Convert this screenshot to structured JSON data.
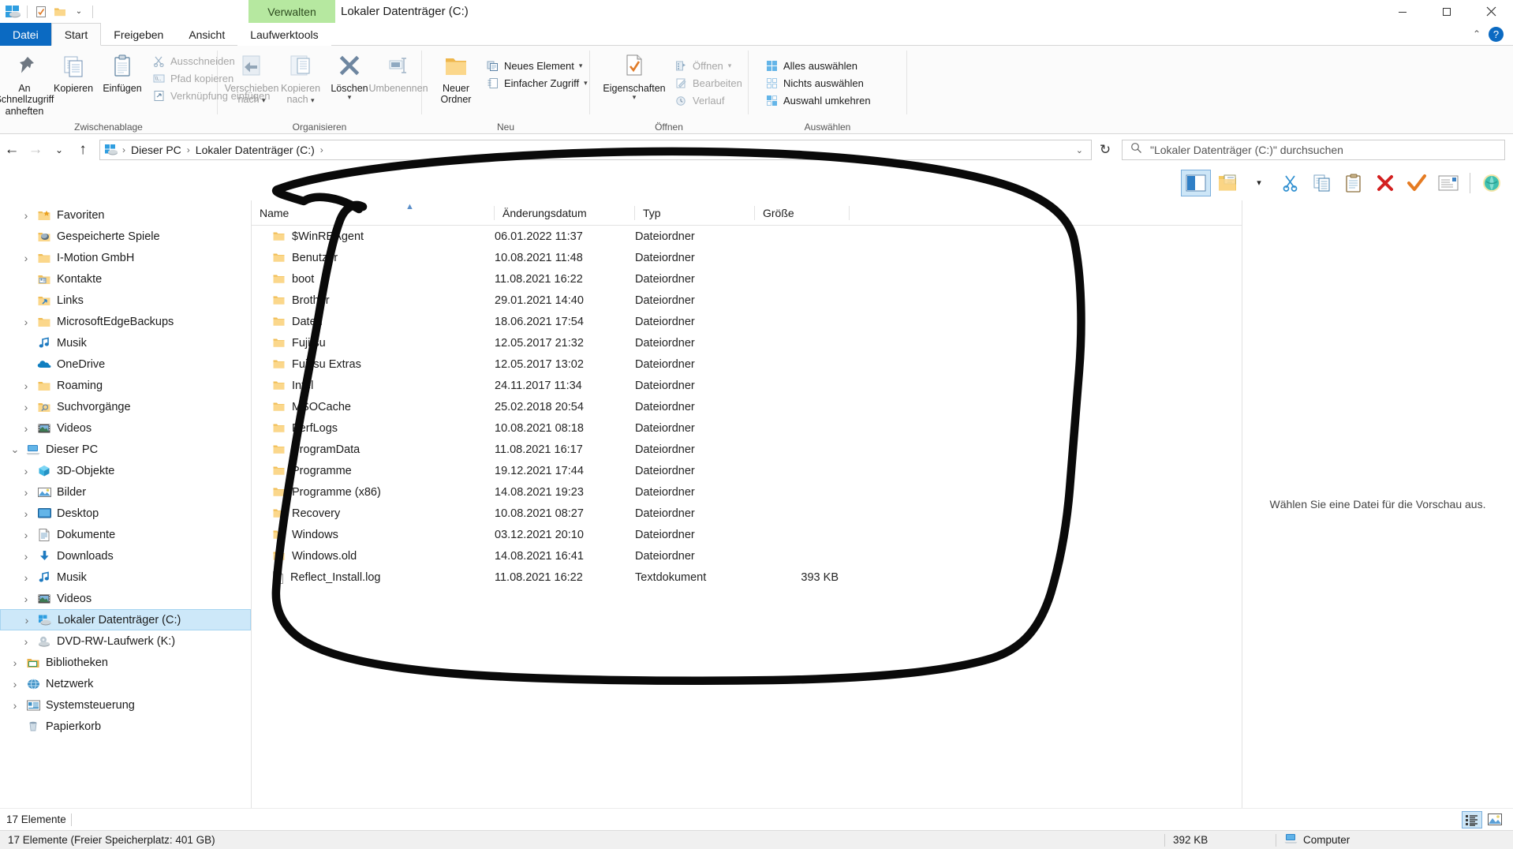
{
  "window": {
    "title": "Lokaler Datenträger (C:)",
    "contextual_tab": "Verwalten",
    "minimize": "–",
    "maximize": "▢",
    "close": "✕"
  },
  "quick_access": {
    "items": [
      "properties-icon",
      "new-folder-icon",
      "customize-dropdown"
    ]
  },
  "ribbon_tabs": [
    {
      "label": "Datei",
      "kind": "file"
    },
    {
      "label": "Start",
      "kind": "active"
    },
    {
      "label": "Freigeben",
      "kind": "normal"
    },
    {
      "label": "Ansicht",
      "kind": "normal"
    },
    {
      "label": "Laufwerktools",
      "kind": "contextual"
    }
  ],
  "ribbon_collapse_caret": "⌃",
  "help_label": "?",
  "ribbon": {
    "groups": [
      {
        "label": "Zwischenablage",
        "big": [
          {
            "label": "An Schnellzugriff\nanheften",
            "icon": "pin-icon",
            "disabled": false
          },
          {
            "label": "Kopieren",
            "icon": "copy-icon",
            "disabled": false
          },
          {
            "label": "Einfügen",
            "icon": "paste-icon",
            "disabled": false
          }
        ],
        "small": [
          {
            "label": "Ausschneiden",
            "icon": "scissors-icon",
            "disabled": true
          },
          {
            "label": "Pfad kopieren",
            "icon": "copy-path-icon",
            "disabled": true
          },
          {
            "label": "Verknüpfung einfügen",
            "icon": "paste-shortcut-icon",
            "disabled": true
          }
        ]
      },
      {
        "label": "Organisieren",
        "big": [
          {
            "label": "Verschieben\nnach",
            "icon": "move-to-icon",
            "disabled": true,
            "caret": true
          },
          {
            "label": "Kopieren\nnach",
            "icon": "copy-to-icon",
            "disabled": true,
            "caret": true
          },
          {
            "label": "Löschen",
            "icon": "delete-x-icon",
            "disabled": false,
            "caret": true
          },
          {
            "label": "Umbenennen",
            "icon": "rename-icon",
            "disabled": true
          }
        ],
        "small": []
      },
      {
        "label": "Neu",
        "big": [
          {
            "label": "Neuer\nOrdner",
            "icon": "new-folder-icon",
            "disabled": false
          }
        ],
        "small": [
          {
            "label": "Neues Element",
            "icon": "new-item-icon",
            "disabled": false,
            "caret": true
          },
          {
            "label": "Einfacher Zugriff",
            "icon": "easy-access-icon",
            "disabled": false,
            "caret": true
          }
        ]
      },
      {
        "label": "Öffnen",
        "big": [
          {
            "label": "Eigenschaften",
            "icon": "properties-check-icon",
            "disabled": false,
            "caret": true
          }
        ],
        "small": [
          {
            "label": "Öffnen",
            "icon": "open-icon",
            "disabled": true,
            "caret": true
          },
          {
            "label": "Bearbeiten",
            "icon": "edit-icon",
            "disabled": true
          },
          {
            "label": "Verlauf",
            "icon": "history-icon",
            "disabled": true
          }
        ]
      },
      {
        "label": "Auswählen",
        "big": [],
        "small": [
          {
            "label": "Alles auswählen",
            "icon": "select-all-icon",
            "disabled": false
          },
          {
            "label": "Nichts auswählen",
            "icon": "select-none-icon",
            "disabled": false
          },
          {
            "label": "Auswahl umkehren",
            "icon": "invert-selection-icon",
            "disabled": false
          }
        ]
      }
    ]
  },
  "nav": {
    "back": "←",
    "forward": "→",
    "recent": "⌄",
    "up": "↑",
    "refresh": "↻",
    "breadcrumb": [
      "Dieser PC",
      "Lokaler Datenträger (C:)"
    ],
    "breadcrumb_sep": "›",
    "dropdown_caret": "⌄"
  },
  "search": {
    "placeholder": "\"Lokaler Datenträger (C:)\" durchsuchen",
    "icon": "search-icon"
  },
  "toolbar2": {
    "buttons": [
      {
        "icon": "preview-pane-icon",
        "selected": true
      },
      {
        "icon": "folder-options-icon",
        "selected": false
      },
      {
        "icon": "dropdown-caret-icon",
        "selected": false
      },
      {
        "icon": "cut-scissors-icon",
        "selected": false
      },
      {
        "icon": "copy-icon",
        "selected": false
      },
      {
        "icon": "paste-clipboard-icon",
        "selected": false
      },
      {
        "icon": "delete-red-x-icon",
        "selected": false
      },
      {
        "icon": "confirm-orange-check-icon",
        "selected": false
      },
      {
        "icon": "rename-icon",
        "selected": false
      },
      {
        "icon": "shell-green-icon",
        "selected": false
      }
    ]
  },
  "sidebar": {
    "items": [
      {
        "label": "Favoriten",
        "icon": "favorites-folder-icon",
        "indent": 1,
        "chevron": true
      },
      {
        "label": "Gespeicherte Spiele",
        "icon": "saved-games-icon",
        "indent": 1,
        "chevron": false
      },
      {
        "label": "I-Motion GmbH",
        "icon": "folder-icon",
        "indent": 1,
        "chevron": true
      },
      {
        "label": "Kontakte",
        "icon": "contacts-icon",
        "indent": 1,
        "chevron": false
      },
      {
        "label": "Links",
        "icon": "links-folder-icon",
        "indent": 1,
        "chevron": false
      },
      {
        "label": "MicrosoftEdgeBackups",
        "icon": "folder-icon",
        "indent": 1,
        "chevron": true
      },
      {
        "label": "Musik",
        "icon": "music-note-icon",
        "indent": 1,
        "chevron": false
      },
      {
        "label": "OneDrive",
        "icon": "onedrive-cloud-icon",
        "indent": 1,
        "chevron": false
      },
      {
        "label": "Roaming",
        "icon": "folder-icon",
        "indent": 1,
        "chevron": true
      },
      {
        "label": "Suchvorgänge",
        "icon": "search-folder-icon",
        "indent": 1,
        "chevron": true
      },
      {
        "label": "Videos",
        "icon": "videos-icon",
        "indent": 1,
        "chevron": true
      },
      {
        "label": "Dieser PC",
        "icon": "this-pc-icon",
        "indent": 0,
        "chevron": true,
        "expanded": true
      },
      {
        "label": "3D-Objekte",
        "icon": "3d-objects-icon",
        "indent": 1,
        "chevron": true
      },
      {
        "label": "Bilder",
        "icon": "pictures-icon",
        "indent": 1,
        "chevron": true
      },
      {
        "label": "Desktop",
        "icon": "desktop-icon",
        "indent": 1,
        "chevron": true
      },
      {
        "label": "Dokumente",
        "icon": "documents-icon",
        "indent": 1,
        "chevron": true
      },
      {
        "label": "Downloads",
        "icon": "downloads-arrow-icon",
        "indent": 1,
        "chevron": true
      },
      {
        "label": "Musik",
        "icon": "music-note-icon",
        "indent": 1,
        "chevron": true
      },
      {
        "label": "Videos",
        "icon": "videos-icon",
        "indent": 1,
        "chevron": true
      },
      {
        "label": "Lokaler Datenträger (C:)",
        "icon": "local-disk-icon",
        "indent": 1,
        "chevron": true,
        "selected": true
      },
      {
        "label": "DVD-RW-Laufwerk (K:)",
        "icon": "dvd-drive-icon",
        "indent": 1,
        "chevron": true
      },
      {
        "label": "Bibliotheken",
        "icon": "libraries-icon",
        "indent": 0,
        "chevron": true
      },
      {
        "label": "Netzwerk",
        "icon": "network-icon",
        "indent": 0,
        "chevron": true
      },
      {
        "label": "Systemsteuerung",
        "icon": "control-panel-icon",
        "indent": 0,
        "chevron": true
      },
      {
        "label": "Papierkorb",
        "icon": "recycle-bin-icon",
        "indent": 0,
        "chevron": false
      }
    ]
  },
  "file_list": {
    "columns": [
      "Name",
      "Änderungsdatum",
      "Typ",
      "Größe"
    ],
    "sort_column": "Name",
    "sort_direction": "asc",
    "rows": [
      {
        "name": "$WinREAgent",
        "date": "06.01.2022 11:37",
        "type": "Dateiordner",
        "size": "",
        "icon": "folder-icon"
      },
      {
        "name": "Benutzer",
        "date": "10.08.2021 11:48",
        "type": "Dateiordner",
        "size": "",
        "icon": "folder-icon"
      },
      {
        "name": "boot",
        "date": "11.08.2021 16:22",
        "type": "Dateiordner",
        "size": "",
        "icon": "folder-icon"
      },
      {
        "name": "Brother",
        "date": "29.01.2021 14:40",
        "type": "Dateiordner",
        "size": "",
        "icon": "folder-icon"
      },
      {
        "name": "Daten",
        "date": "18.06.2021 17:54",
        "type": "Dateiordner",
        "size": "",
        "icon": "folder-icon"
      },
      {
        "name": "Fujitsu",
        "date": "12.05.2017 21:32",
        "type": "Dateiordner",
        "size": "",
        "icon": "folder-icon"
      },
      {
        "name": "Fujitsu Extras",
        "date": "12.05.2017 13:02",
        "type": "Dateiordner",
        "size": "",
        "icon": "folder-icon"
      },
      {
        "name": "Intel",
        "date": "24.11.2017 11:34",
        "type": "Dateiordner",
        "size": "",
        "icon": "folder-icon"
      },
      {
        "name": "MSOCache",
        "date": "25.02.2018 20:54",
        "type": "Dateiordner",
        "size": "",
        "icon": "folder-icon"
      },
      {
        "name": "PerfLogs",
        "date": "10.08.2021 08:18",
        "type": "Dateiordner",
        "size": "",
        "icon": "folder-icon"
      },
      {
        "name": "ProgramData",
        "date": "11.08.2021 16:17",
        "type": "Dateiordner",
        "size": "",
        "icon": "folder-icon"
      },
      {
        "name": "Programme",
        "date": "19.12.2021 17:44",
        "type": "Dateiordner",
        "size": "",
        "icon": "folder-icon"
      },
      {
        "name": "Programme (x86)",
        "date": "14.08.2021 19:23",
        "type": "Dateiordner",
        "size": "",
        "icon": "folder-icon"
      },
      {
        "name": "Recovery",
        "date": "10.08.2021 08:27",
        "type": "Dateiordner",
        "size": "",
        "icon": "folder-icon"
      },
      {
        "name": "Windows",
        "date": "03.12.2021 20:10",
        "type": "Dateiordner",
        "size": "",
        "icon": "folder-icon"
      },
      {
        "name": "Windows.old",
        "date": "14.08.2021 16:41",
        "type": "Dateiordner",
        "size": "",
        "icon": "folder-icon"
      },
      {
        "name": "Reflect_Install.log",
        "date": "11.08.2021 16:22",
        "type": "Textdokument",
        "size": "393 KB",
        "icon": "text-file-icon"
      }
    ]
  },
  "preview": {
    "message": "Wählen Sie eine Datei für die Vorschau aus."
  },
  "item_count_bar": {
    "text": "17 Elemente",
    "view_details_icon": "details-view-icon",
    "view_thumbs_icon": "large-icons-view-icon"
  },
  "status_bar": {
    "items_text": "17 Elemente (Freier Speicherplatz: 401 GB)",
    "size_text": "392 KB",
    "location_text": "Computer",
    "location_icon": "computer-icon"
  },
  "annotation": {
    "type": "hand-drawn-circle",
    "color": "#000000",
    "target": "file-list-region"
  },
  "colors": {
    "accent_blue": "#0b6ac2",
    "contextual_green": "#b6e8a0",
    "selection_blue": "#cde8f9",
    "folder_yellow": "#f7d071"
  }
}
